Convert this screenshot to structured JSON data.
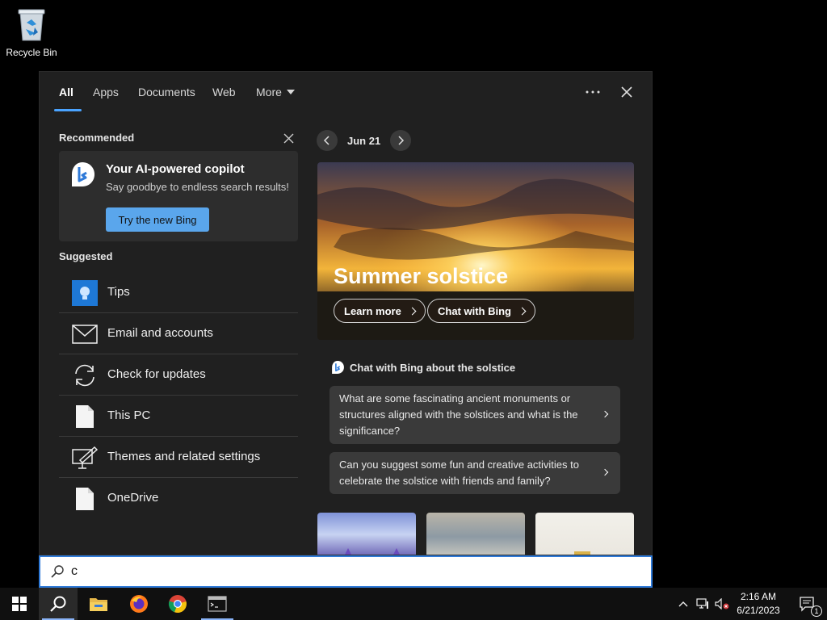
{
  "desktop": {
    "recycle_bin_label": "Recycle Bin"
  },
  "tabs": [
    {
      "label": "All"
    },
    {
      "label": "Apps"
    },
    {
      "label": "Documents"
    },
    {
      "label": "Web"
    },
    {
      "label": "More"
    }
  ],
  "recommended": {
    "heading": "Recommended",
    "card_title": "Your AI-powered copilot",
    "card_subtitle": "Say goodbye to endless search results!",
    "card_button": "Try the new Bing"
  },
  "suggested": {
    "heading": "Suggested",
    "items": [
      {
        "label": "Tips",
        "icon": "tips-lightbulb-icon"
      },
      {
        "label": "Email and accounts",
        "icon": "envelope-icon"
      },
      {
        "label": "Check for updates",
        "icon": "refresh-icon"
      },
      {
        "label": "This PC",
        "icon": "document-icon"
      },
      {
        "label": "Themes and related settings",
        "icon": "themes-pen-icon"
      },
      {
        "label": "OneDrive",
        "icon": "document-icon"
      }
    ]
  },
  "highlight": {
    "date": "Jun 21",
    "hero_title": "Summer solstice",
    "learn_more": "Learn more",
    "chat_with_bing": "Chat with Bing",
    "chat_heading": "Chat with Bing about the solstice",
    "questions": [
      "What are some fascinating ancient monuments or structures aligned with the solstices and what is the significance?",
      "Can you suggest some fun and creative activities to celebrate the solstice with friends and family?"
    ]
  },
  "search": {
    "value": "c"
  },
  "taskbar": {
    "apps": [
      "windows-start-icon",
      "search-icon",
      "file-explorer-icon",
      "firefox-icon",
      "chrome-icon",
      "terminal-icon"
    ],
    "time": "2:16 AM",
    "date": "6/21/2023",
    "notification_count": "1"
  },
  "colors": {
    "accent": "#4aa3ff",
    "panel_bg": "#202020",
    "bing_button": "#5aa6ec"
  }
}
